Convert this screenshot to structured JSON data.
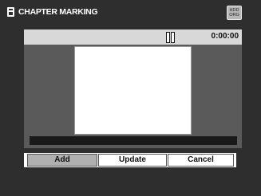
{
  "header": {
    "title": "CHAPTER MARKING",
    "title_icon": "chapter-icon",
    "badge_line1": "HDD",
    "badge_line2": "ORG"
  },
  "playback": {
    "state_icon": "pause-icon",
    "time": "0:00:00"
  },
  "buttons": {
    "add_label": "Add",
    "update_label": "Update",
    "cancel_label": "Cancel",
    "selected": "Add"
  },
  "colors": {
    "background": "#2e2e2e",
    "panel": "#5a5a5a",
    "status_strip": "#d8d8d8",
    "selected_button": "#b0b0b0"
  }
}
